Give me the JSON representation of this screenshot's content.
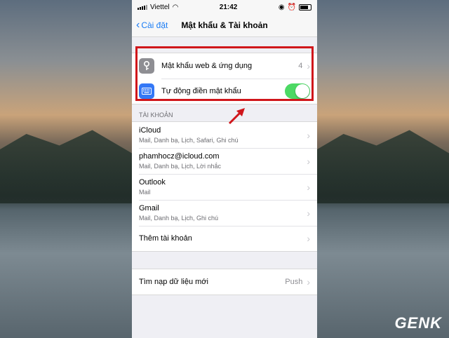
{
  "status_bar": {
    "carrier": "Viettel",
    "time": "21:42"
  },
  "nav": {
    "back_label": "Cài đặt",
    "title": "Mật khẩu & Tài khoản"
  },
  "password_group": {
    "items": [
      {
        "label": "Mật khẩu web & ứng dụng",
        "value": "4",
        "icon": "key-icon"
      },
      {
        "label": "Tự động điền mật khẩu",
        "toggle": true,
        "icon": "keyboard-icon"
      }
    ]
  },
  "accounts": {
    "header": "TÀI KHOẢN",
    "items": [
      {
        "title": "iCloud",
        "subtitle": "Mail, Danh bạ, Lịch, Safari, Ghi chú"
      },
      {
        "title": "phamhocz@icloud.com",
        "subtitle": "Mail, Danh bạ, Lịch, Lời nhắc"
      },
      {
        "title": "Outlook",
        "subtitle": "Mail"
      },
      {
        "title": "Gmail",
        "subtitle": "Mail, Danh bạ, Lịch, Ghi chú"
      },
      {
        "title": "Thêm tài khoản",
        "subtitle": ""
      }
    ]
  },
  "fetch": {
    "label": "Tìm nạp dữ liệu mới",
    "value": "Push"
  },
  "watermark": "GENK",
  "colors": {
    "accent": "#1a7cf5",
    "toggle_on": "#4cd964",
    "highlight": "#d0161b"
  }
}
